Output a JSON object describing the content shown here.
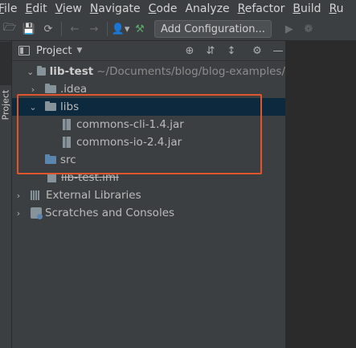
{
  "menu": [
    {
      "mnemonic": "F",
      "rest": "ile"
    },
    {
      "mnemonic": "E",
      "rest": "dit"
    },
    {
      "mnemonic": "V",
      "rest": "iew"
    },
    {
      "mnemonic": "N",
      "rest": "avigate"
    },
    {
      "mnemonic": "C",
      "rest": "ode"
    },
    {
      "mnemonic": "",
      "rest": "Analyze"
    },
    {
      "mnemonic": "R",
      "rest": "efactor"
    },
    {
      "mnemonic": "B",
      "rest": "uild"
    },
    {
      "mnemonic": "R",
      "rest": "u"
    }
  ],
  "toolbar": {
    "add_configuration": "Add Configuration..."
  },
  "stripe": {
    "project_label": "Project"
  },
  "panel": {
    "title": "Project"
  },
  "tree": {
    "root": {
      "name": "lib-test",
      "path": "~/Documents/blog/blog-examples/"
    },
    "idea": ".idea",
    "libs": "libs",
    "jar1": "commons-cli-1.4.jar",
    "jar2": "commons-io-2.4.jar",
    "src": "src",
    "iml": "lib-test.iml",
    "external_libraries": "External Libraries",
    "scratches": "Scratches and Consoles"
  },
  "colors": {
    "highlight": "#e0562c",
    "selection": "#0d293e",
    "panel_bg": "#3c3f41",
    "editor_bg": "#2b2b2b"
  }
}
